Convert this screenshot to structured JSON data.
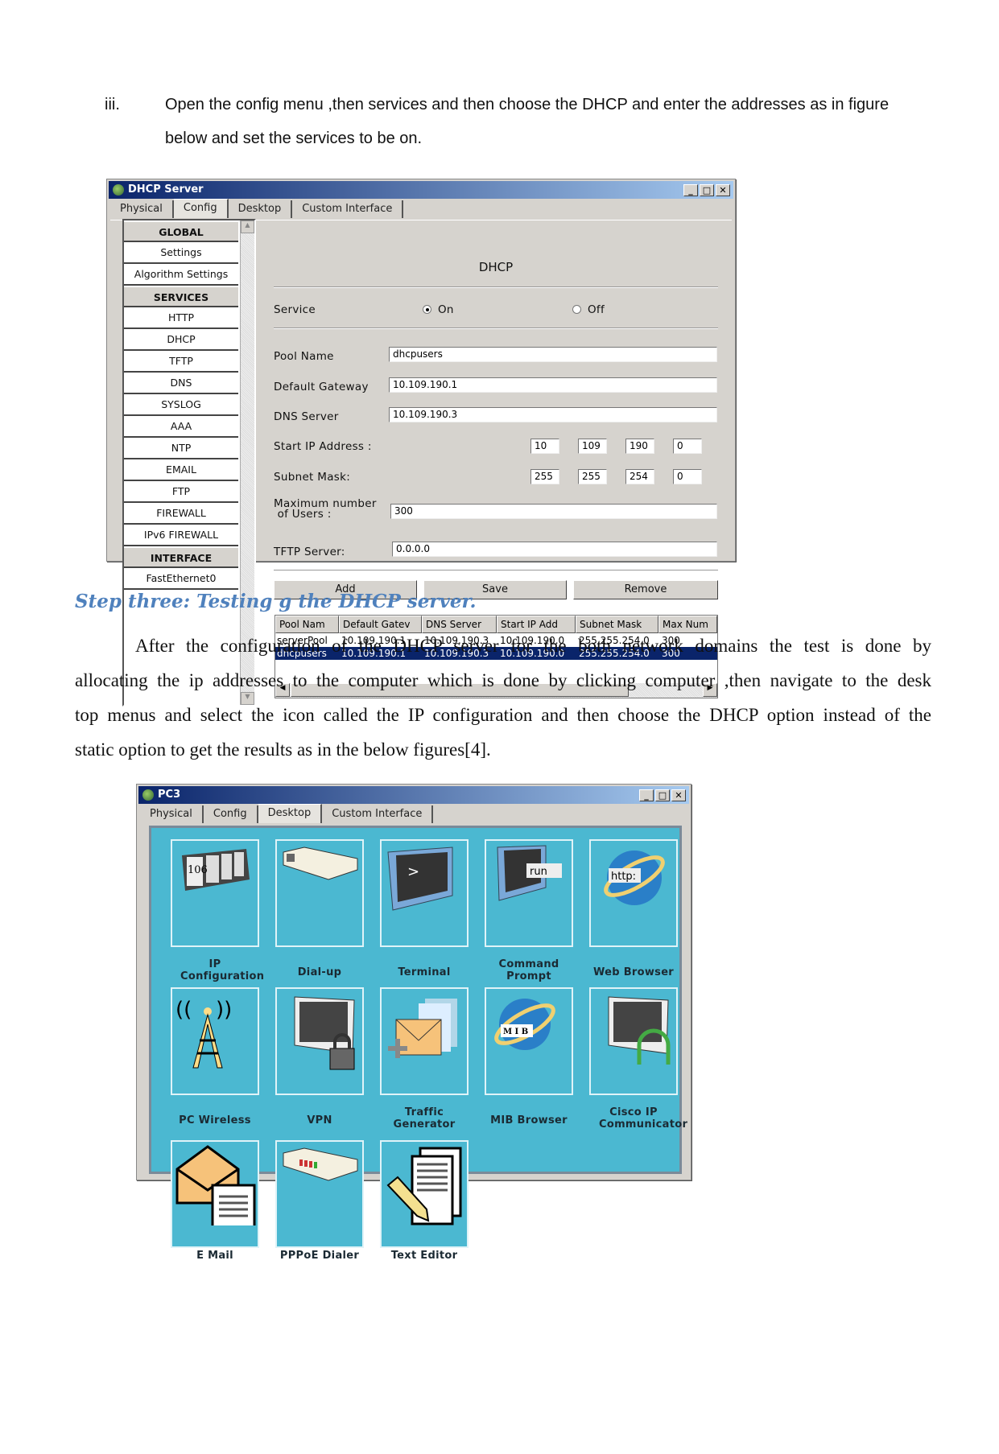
{
  "instruction": {
    "marker": "iii.",
    "line1": "Open the config menu ,then  services and then choose the DHCP and enter the addresses as  in figure",
    "line2": "below  and set the services to be on."
  },
  "dhcp_window": {
    "title": "DHCP Server",
    "tabs": [
      "Physical",
      "Config",
      "Desktop",
      "Custom Interface"
    ],
    "active_tab": "Config",
    "sidebar": [
      {
        "label": "GLOBAL",
        "header": true
      },
      {
        "label": "Settings"
      },
      {
        "label": "Algorithm Settings"
      },
      {
        "label": "SERVICES",
        "header": true
      },
      {
        "label": "HTTP"
      },
      {
        "label": "DHCP"
      },
      {
        "label": "TFTP"
      },
      {
        "label": "DNS"
      },
      {
        "label": "SYSLOG"
      },
      {
        "label": "AAA"
      },
      {
        "label": "NTP"
      },
      {
        "label": "EMAIL"
      },
      {
        "label": "FTP"
      },
      {
        "label": "FIREWALL"
      },
      {
        "label": "IPv6 FIREWALL"
      },
      {
        "label": "INTERFACE",
        "header": true
      },
      {
        "label": "FastEthernet0"
      }
    ],
    "heading": "DHCP",
    "service_label": "Service",
    "on_label": "On",
    "off_label": "Off",
    "service_value": "On",
    "pool_name_label": "Pool Name",
    "pool_name": "dhcpusers",
    "gateway_label": "Default Gateway",
    "gateway": "10.109.190.1",
    "dns_label": "DNS Server",
    "dns": "10.109.190.3",
    "start_ip_label": "Start IP Address :",
    "start_ip": [
      "10",
      "109",
      "190",
      "0"
    ],
    "subnet_label": "Subnet Mask:",
    "subnet": [
      "255",
      "255",
      "254",
      "0"
    ],
    "max_users_label1": "Maximum number",
    "max_users_label2": " of Users :",
    "max_users": "300",
    "tftp_label": "TFTP Server:",
    "tftp": "0.0.0.0",
    "buttons": {
      "add": "Add",
      "save": "Save",
      "remove": "Remove"
    },
    "table": {
      "columns": [
        "Pool Nam",
        "Default Gatev",
        "DNS Server",
        "Start IP Add",
        "Subnet Mask",
        "Max Num"
      ],
      "rows": [
        [
          "serverPool",
          "10.109.190.1",
          "10.109.190.3",
          "10.109.190.0",
          "255.255.254.0",
          "300"
        ],
        [
          "dhcpusers",
          "10.109.190.1",
          "10.109.190.3",
          "10.109.190.0",
          "255.255.254.0",
          "300"
        ]
      ],
      "selected_row": 1
    }
  },
  "step_heading": "Step three: Testing g the DHCP server.",
  "paragraph": [
    "After the configuration of the DHCP server for the both network domains the test is done by",
    "allocating the ip addresses to the computer which is done by clicking computer ,then navigate to the desk",
    "top menus and select the icon called the IP configuration and then choose the DHCP option instead of the",
    "static option to get the results as in the below figures[4]."
  ],
  "pc_window": {
    "title": "PC3",
    "tabs": [
      "Physical",
      "Config",
      "Desktop",
      "Custom Interface"
    ],
    "active_tab": "Desktop",
    "apps": [
      {
        "label": "IP Configuration",
        "icon": "ip-configuration-icon"
      },
      {
        "label": "Dial-up",
        "icon": "modem-icon"
      },
      {
        "label": "Terminal",
        "icon": "terminal-icon"
      },
      {
        "label": "Command Prompt",
        "icon": "command-prompt-icon",
        "badge": "run"
      },
      {
        "label": "Web Browser",
        "icon": "web-browser-icon",
        "badge": "http:"
      },
      {
        "label": "PC Wireless",
        "icon": "wireless-tower-icon"
      },
      {
        "label": "VPN",
        "icon": "vpn-lock-icon"
      },
      {
        "label": "Traffic Generator",
        "icon": "traffic-generator-icon"
      },
      {
        "label": "MIB Browser",
        "icon": "mib-browser-icon",
        "badge": "M I B"
      },
      {
        "label": "Cisco IP Communicator",
        "icon": "ip-communicator-icon"
      },
      {
        "label": "E Mail",
        "icon": "email-icon"
      },
      {
        "label": "PPPoE Dialer",
        "icon": "pppoe-dialer-icon"
      },
      {
        "label": "Text Editor",
        "icon": "text-editor-icon"
      }
    ],
    "ip_icon_text": "106",
    "panel_color": "#4bb8d1"
  }
}
